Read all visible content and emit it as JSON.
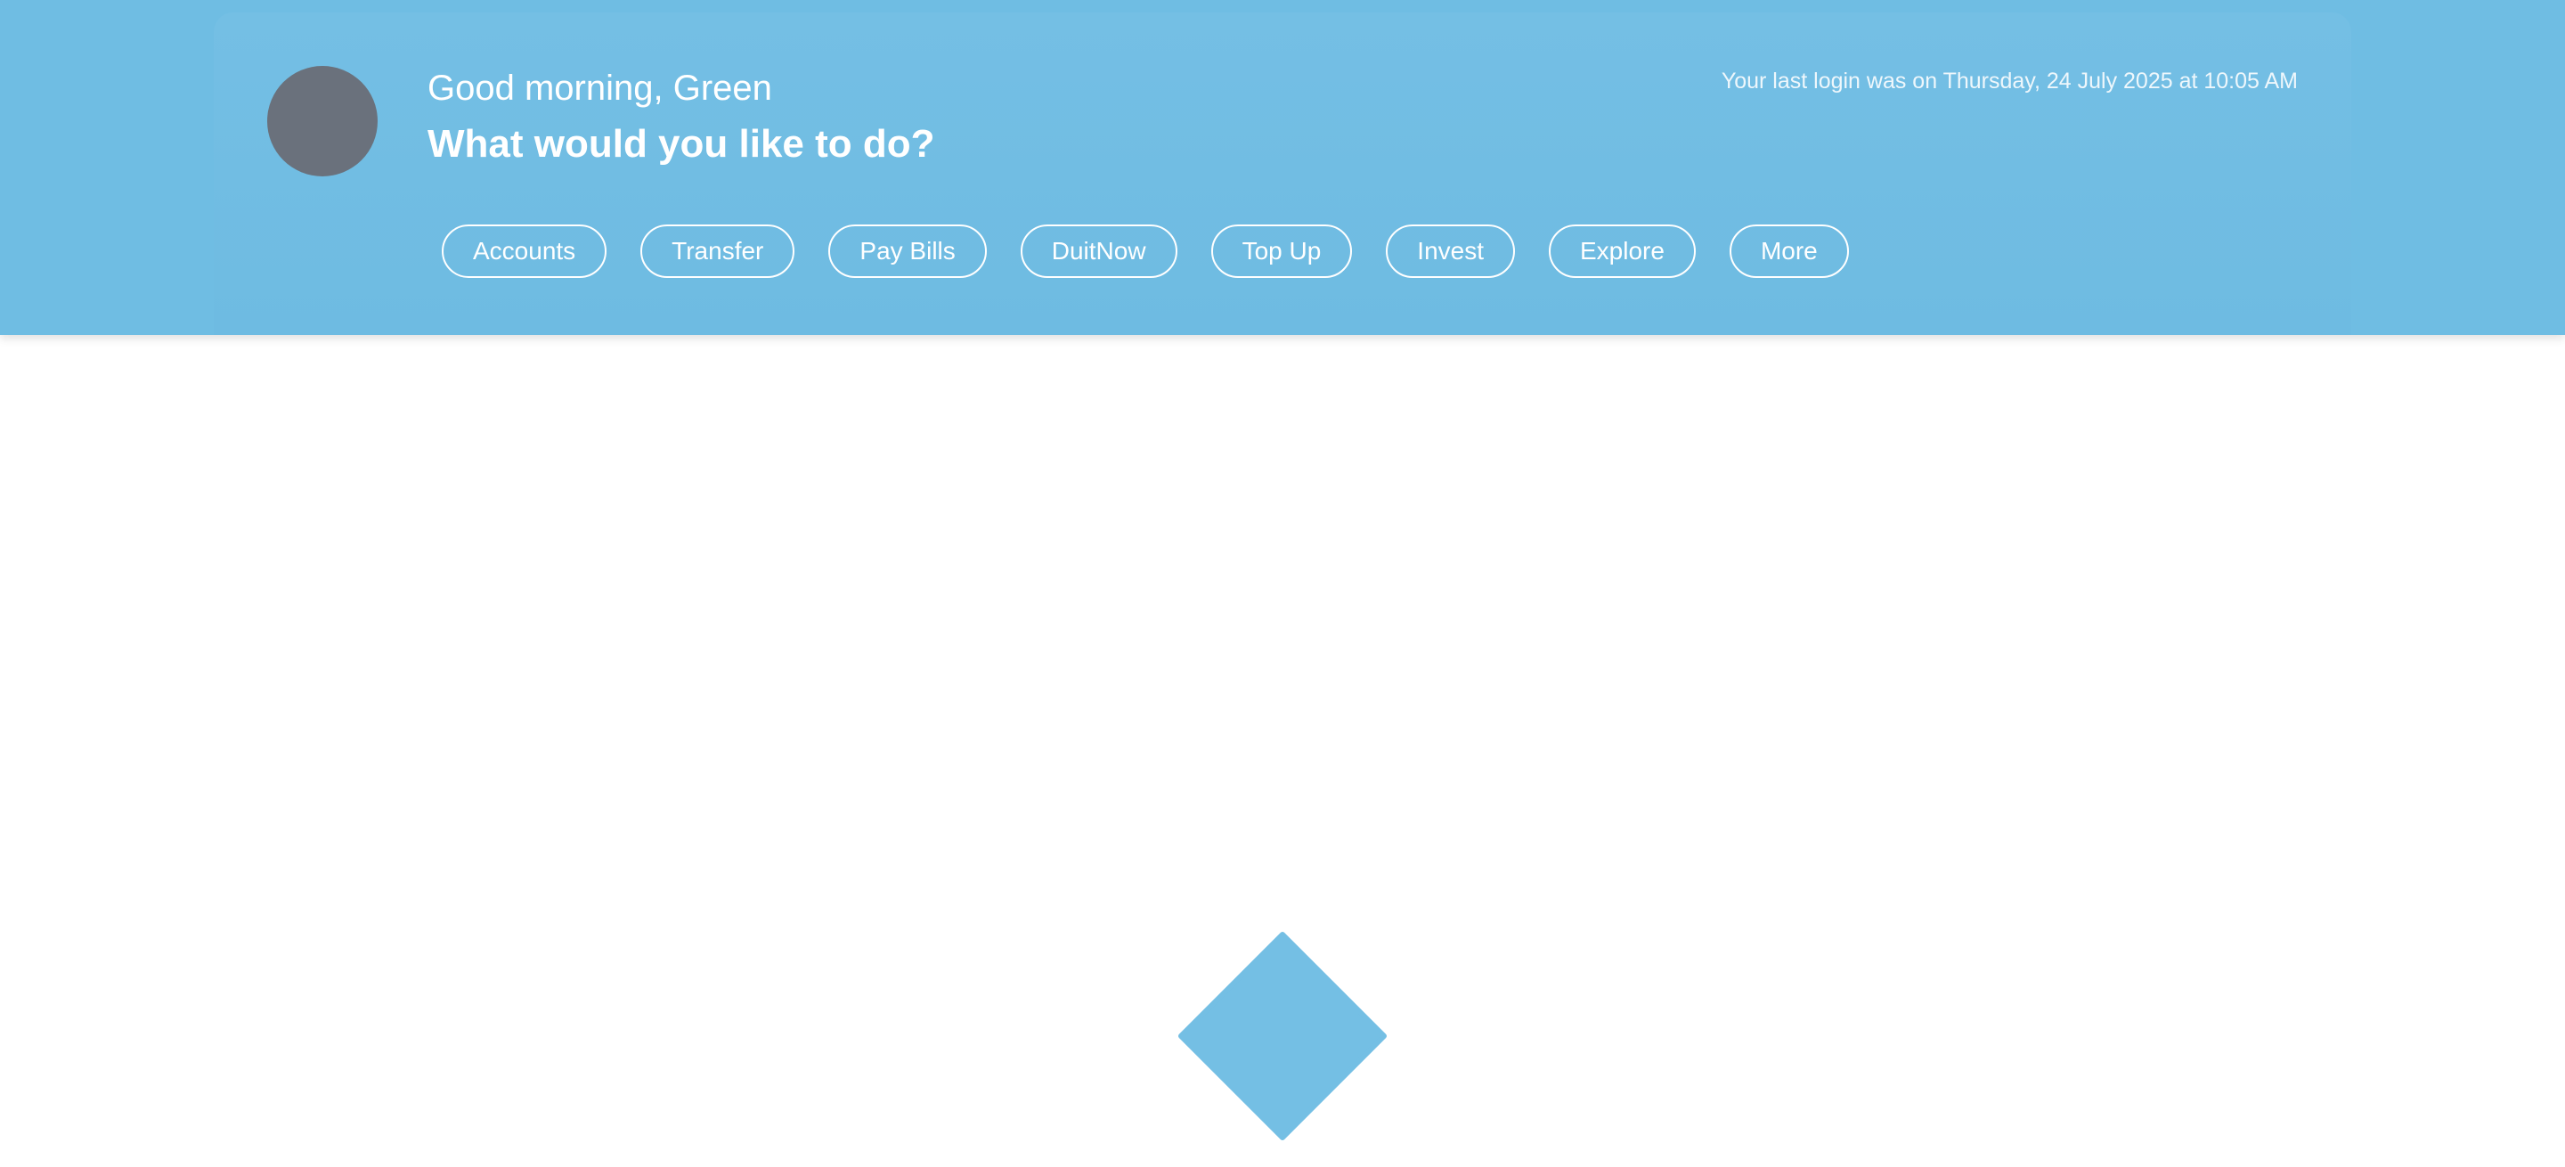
{
  "header": {
    "greeting": "Good morning, Green",
    "prompt": "What would you like to do?",
    "last_login": "Your last login was on Thursday, 24 July 2025 at 10:05 AM"
  },
  "actions": [
    {
      "label": "Accounts"
    },
    {
      "label": "Transfer"
    },
    {
      "label": "Pay Bills"
    },
    {
      "label": "DuitNow"
    },
    {
      "label": "Top Up"
    },
    {
      "label": "Invest"
    },
    {
      "label": "Explore"
    },
    {
      "label": "More"
    }
  ],
  "loader": {
    "icon": "diamond-loader-icon",
    "color": "#74bfe4"
  },
  "colors": {
    "header_background": "#6fbde3",
    "avatar": "#6a717c"
  }
}
